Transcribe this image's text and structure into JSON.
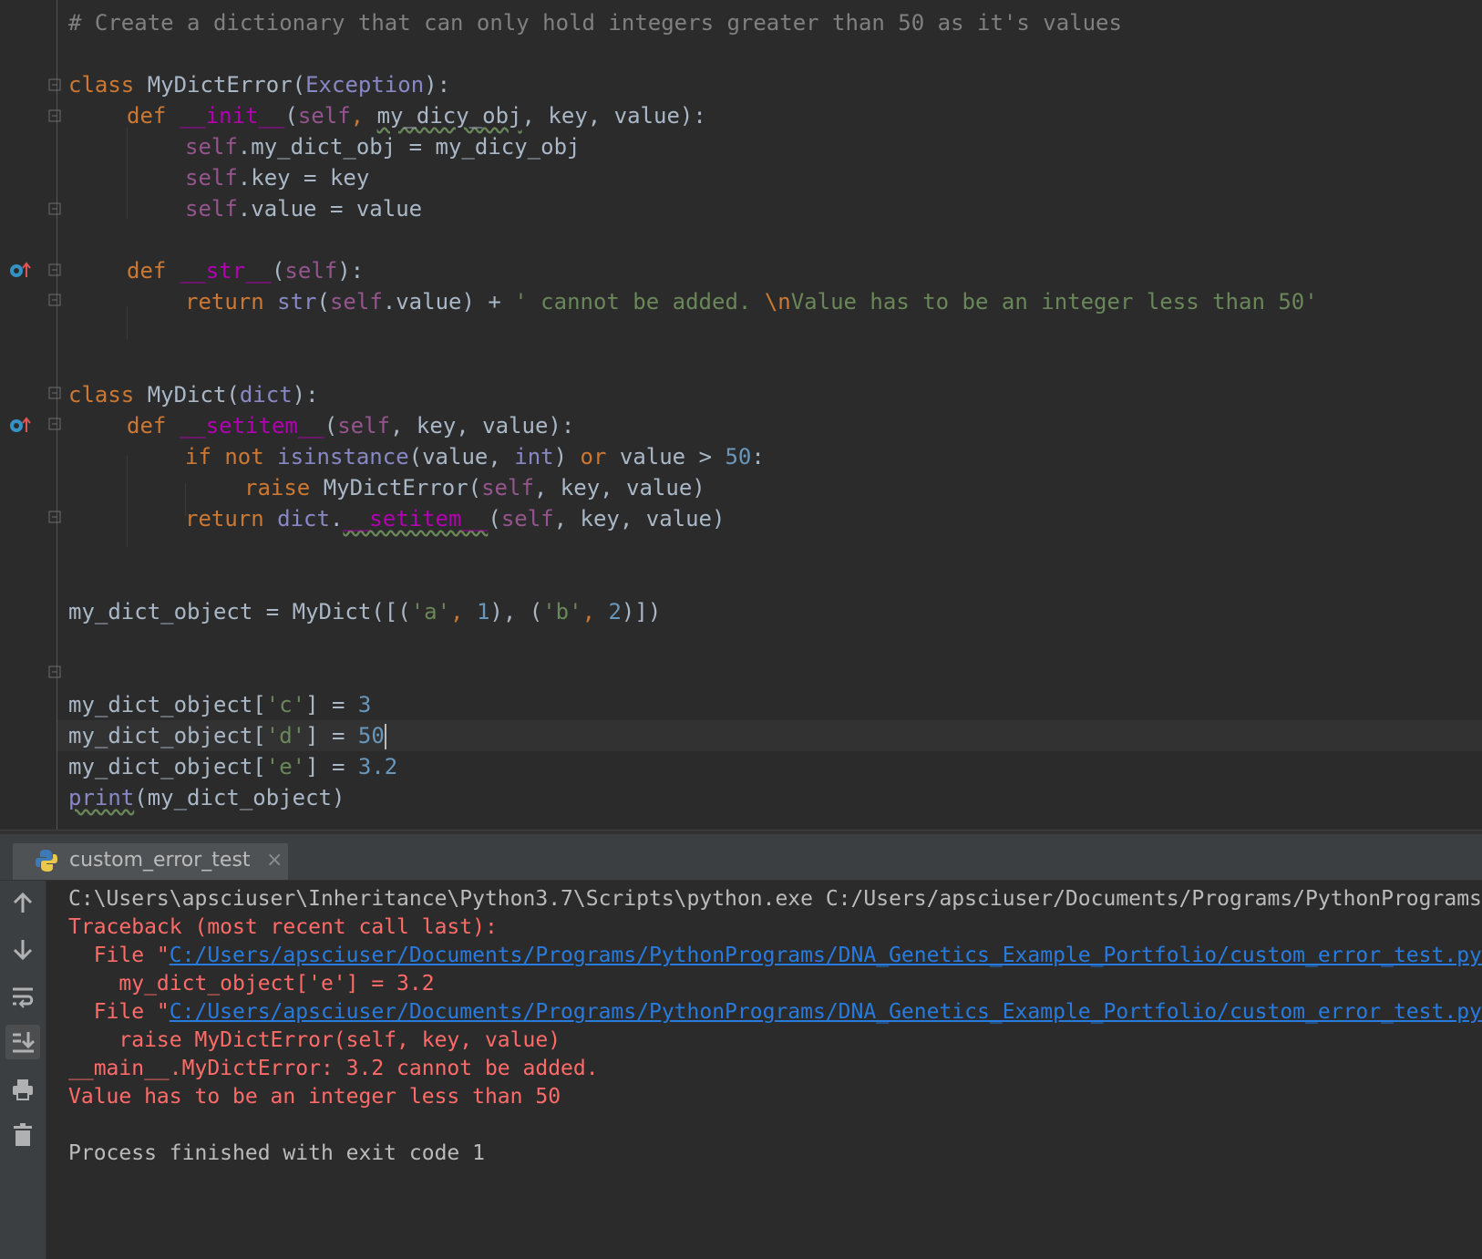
{
  "editor": {
    "lines": {
      "comment": "# Create a dictionary that can only hold integers greater than 50 as it's values",
      "l2_kw": "class",
      "l2_name": " MyDictError(",
      "l2_base": "Exception",
      "l2_end": "):",
      "l3_def": "def",
      "l3_fn": "__init__",
      "l3_open": "(",
      "l3_self": "self",
      "l3_c1": ", ",
      "l3_arg1": "my_dicy_obj",
      "l3_c2": ", key, value):",
      "l4_self": "self",
      "l4_rest": ".my_dict_obj = my_dicy_obj",
      "l5_self": "self",
      "l5_rest": ".key = key",
      "l6_self": "self",
      "l6_rest": ".value = value",
      "l8_def": "def",
      "l8_fn": "__str__",
      "l8_open": "(",
      "l8_self": "self",
      "l8_end": "):",
      "l9_ret": "return",
      "l9_str": "str",
      "l9_open": "(",
      "l9_self": "self",
      "l9_mid": ".value) + ",
      "l9_lit1": "' cannot be added. ",
      "l9_esc": "\\n",
      "l9_lit2": "Value has to be an integer less than 50'",
      "l12_kw": "class",
      "l12_name": " MyDict(",
      "l12_base": "dict",
      "l12_end": "):",
      "l13_def": "def",
      "l13_fn": "__setitem__",
      "l13_open": "(",
      "l13_self": "self",
      "l13_rest": ", key, value):",
      "l14_if": "if not",
      "l14_isinst": "isinstance",
      "l14_mid": "(value, ",
      "l14_int": "int",
      "l14_close": ") ",
      "l14_or": "or",
      "l14_cmp": " value > ",
      "l14_num": "50",
      "l14_colon": ":",
      "l15_raise": "raise",
      "l15_mid": " MyDictError(",
      "l15_self": "self",
      "l15_rest": ", key, value)",
      "l16_ret": "return",
      "l16_dict": "dict",
      "l16_dot": ".",
      "l16_fn": "__setitem__",
      "l16_open": "(",
      "l16_self": "self",
      "l16_rest": ", key, value)",
      "l19_a": "my_dict_object = MyDict([(",
      "l19_s1": "'a'",
      "l19_c1": ", ",
      "l19_n1": "1",
      "l19_c2": "), (",
      "l19_s2": "'b'",
      "l19_c3": ", ",
      "l19_n2": "2",
      "l19_end": ")])",
      "l22_a": "my_dict_object[",
      "l22_s": "'c'",
      "l22_b": "] = ",
      "l22_n": "3",
      "l23_a": "my_dict_object[",
      "l23_s": "'d'",
      "l23_b": "] = ",
      "l23_n": "50",
      "l24_a": "my_dict_object[",
      "l24_s": "'e'",
      "l24_b": "] = ",
      "l24_n": "3.2",
      "l25_print": "print",
      "l25_rest": "(my_dict_object)"
    }
  },
  "run_panel": {
    "tab_label": "custom_error_test",
    "tab_close": "×",
    "output": {
      "cmd": "C:\\Users\\apsciuser\\Inheritance\\Python3.7\\Scripts\\python.exe C:/Users/apsciuser/Documents/Programs/PythonPrograms",
      "traceback": "Traceback (most recent call last):",
      "file1_prefix": "  File \"",
      "file1_link": "C:/Users/apsciuser/Documents/Programs/PythonPrograms/DNA_Genetics_Example_Portfolio/custom_error_test.py",
      "file1_code": "    my_dict_object['e'] = 3.2",
      "file2_prefix": "  File \"",
      "file2_link": "C:/Users/apsciuser/Documents/Programs/PythonPrograms/DNA_Genetics_Example_Portfolio/custom_error_test.py",
      "file2_code": "    raise MyDictError(self, key, value)",
      "error1": "__main__.MyDictError: 3.2 cannot be added.",
      "error2": "Value has to be an integer less than 50",
      "exit": "Process finished with exit code 1"
    }
  },
  "colors": {
    "background": "#2b2b2b",
    "keyword": "#cc7832",
    "string": "#6a8759",
    "number": "#6897bb",
    "error": "#ff6b68",
    "link": "#287bde"
  },
  "icons": [
    "fold-marker-icon",
    "override-method-icon",
    "python-file-icon",
    "close-icon",
    "up-arrow-icon",
    "down-arrow-icon",
    "soft-wrap-icon",
    "scroll-to-end-icon",
    "print-icon",
    "trash-icon"
  ]
}
